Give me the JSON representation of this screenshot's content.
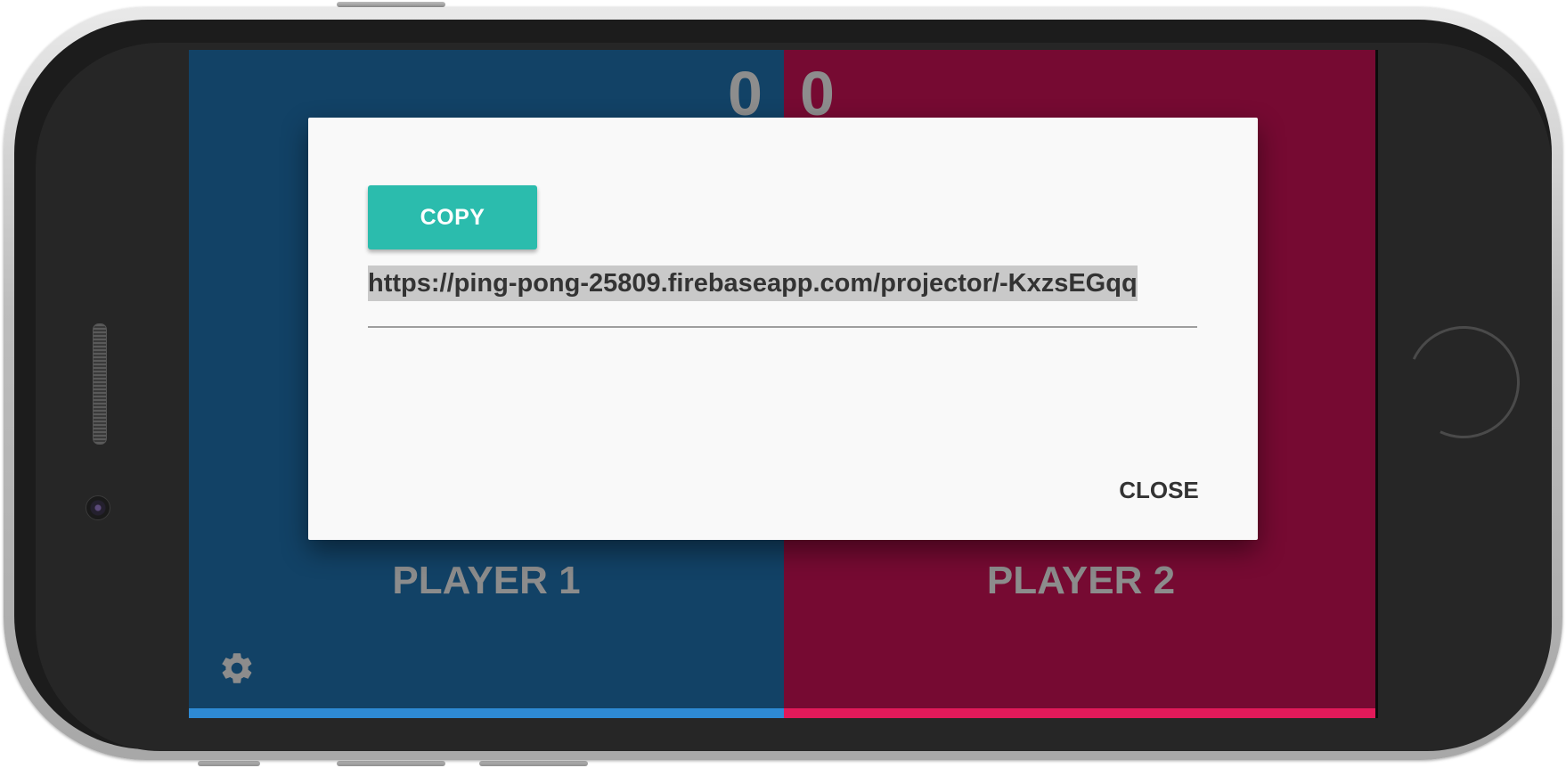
{
  "scores": {
    "player1": "0",
    "player2": "0"
  },
  "players": {
    "player1_label": "PLAYER 1",
    "player2_label": "PLAYER 2"
  },
  "colors": {
    "player1_bg": "#124266",
    "player2_bg": "#760a32",
    "player1_bar": "#2e8ad4",
    "player2_bar": "#e21a5a",
    "accent_button": "#2bbcad",
    "dialog_bg": "#f9f9f9"
  },
  "dialog": {
    "copy_label": "COPY",
    "url_value": "https://ping-pong-25809.firebaseapp.com/projector/-KxzsEGqq",
    "close_label": "CLOSE"
  },
  "icons": {
    "settings": "gear-icon"
  }
}
